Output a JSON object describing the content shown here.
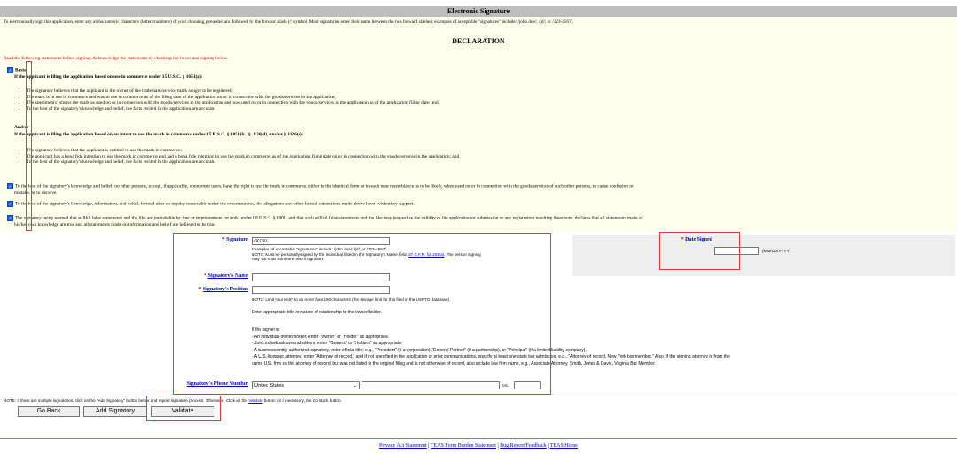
{
  "header": {
    "title": "Electronic Signature"
  },
  "intro": "To electronically sign this application, enter any alpha/numeric characters (letters/numbers) of your choosing, preceded and followed by the forward slash (/) symbol. Most signatories enter their name between the two forward slashes; examples of acceptable \"signatures\" include: /john doe/; /jd/; or /123-4567/.",
  "declaration": {
    "title": "DECLARATION",
    "instruction": "Read the following statements before signing. Acknowledge the statements by checking the boxes and signing below.",
    "basis_label": "Basis:",
    "use_heading": "If the applicant is filing the application based on use in commerce under 15 U.S.C. § 1051(a):",
    "use_items": [
      "The signatory believes that the applicant is the owner of the trademark/service mark sought to be registered;",
      "The mark is in use in commerce and was in use in commerce as of the filing date of the application on or in connection with the goods/services in the application;",
      "The specimen(s) shows the mark as used on or in connection with the goods/services in the application and was used on or in connection with the goods/services in the application as of the application filing date; and",
      "To the best of the signatory's knowledge and belief, the facts recited in the application are accurate."
    ],
    "andor": "And/or",
    "intent_heading": "If the applicant is filing the application based on an intent to use the mark in commerce under 15 U.S.C. § 1051(b), § 1126(d), and/or § 1126(e):",
    "intent_items": [
      "The signatory believes that the applicant is entitled to use the mark in commerce;",
      "The applicant has a bona fide intention to use the mark in commerce and had a bona fide intention to use the mark in commerce as of the application filing date on or in connection with the goods/services in the application; and",
      "To the best of the signatory's knowledge and belief, the facts recited in the application are accurate."
    ],
    "stmt1_a": "To the best of the signatory's knowledge and belief, no other persons, except, if applicable, concurrent users, have the right to use the mark in commerce, either in the identical form or in such near resemblance as to be likely, when used on or in connection with the goods/services of such other persons, to cause confusion or",
    "stmt1_b": "mistake, or to deceive.",
    "stmt2": "To the best of the signatory's knowledge, information, and belief, formed after an inquiry reasonable under the circumstances, the allegations and other factual contentions made above have evidentiary support.",
    "stmt3_a": "The signatory being warned that willful false statements and the like are punishable by fine or imprisonment, or both, under 18 U.S.C. § 1001, and that such willful false statements and the like may jeopardize the validity of the application or submission or any registration resulting therefrom, declares that all statements made of",
    "stmt3_b": "his/her own knowledge are true and all statements made on information and belief are believed to be true."
  },
  "form": {
    "signature_label": "Signature",
    "signature_value": "/XXX/",
    "signature_help1": "Examples of acceptable \"signatures\" include: /john doe/; /jd/; or /123-4567/.",
    "signature_help2_prefix": "NOTE: Must be personally signed by the individual listed in the Signatory's Name field.",
    "signature_help2_link": "37 C.F.R. §2.193(a)",
    "signature_help2_suffix": ". The person signing",
    "signature_help3": "may not enter someone else's signature.",
    "date_label": "Date Signed",
    "date_value": "",
    "date_format": "(MM/DD/YYYY)",
    "name_label": "Signatory's Name",
    "name_value": "",
    "position_label": "Signatory's Position",
    "position_value": "",
    "position_note": "NOTE: Limit your entry to no more than 150 characters (the storage limit for this field in the USPTO database).",
    "position_help": "Enter appropriate title or nature of relationship to the owner/holder.",
    "signer_intro": "If the signer is",
    "signer_1": "- An individual owner/holder, enter \"Owner\" or \"Holder\" as appropriate.",
    "signer_2": "- Joint individual owners/holders, enter \"Owners\" or \"Holders\" as appropriate.",
    "signer_3": "- A business entity authorized signatory, enter official title; e.g., \"President\" (if a corporation),\"General Partner\" (if a partnership), or \"Principal\" (if a limited liability company).",
    "signer_4a": "- A U.S.-licensed attorney, enter \"Attorney of record,\" and if not specified in the application or prior communications, specify at least one state bar admission, e.g., \"Attorney of record, New York bar member.\" Also, if the signing attorney is from the",
    "signer_4b": "same U.S. firm as the attorney of record, but was not listed in the original filing and is not otherwise of record, also include law firm name, e.g., Associate Attorney, Smith, Jones & Davis, Virginia Bar Member.",
    "phone_label": "Signatory's Phone Number",
    "country_value": "United States",
    "phone_value": "",
    "ext_label": "Ext.",
    "ext_value": ""
  },
  "bottom": {
    "note_prefix": "NOTE: If there are multiple signatories, click on the \"Add Signatory\" button below and repeat signature process. Otherwise, Click on the",
    "note_link": "Validate",
    "note_suffix": "button, or if necessary, the Go Back button.",
    "go_back": "Go Back",
    "add_signatory": "Add Signatory",
    "validate": "Validate"
  },
  "footer": {
    "links": [
      "Privacy Act Statement",
      "TEAS Form Burden Statement",
      "Bug Report/Feedback",
      "TEAS Home"
    ],
    "sep": "|"
  },
  "colors": {
    "highlight": "#e53935",
    "link": "#0000cc",
    "required": "#cc0000",
    "checkbox": "#1f66d6"
  }
}
